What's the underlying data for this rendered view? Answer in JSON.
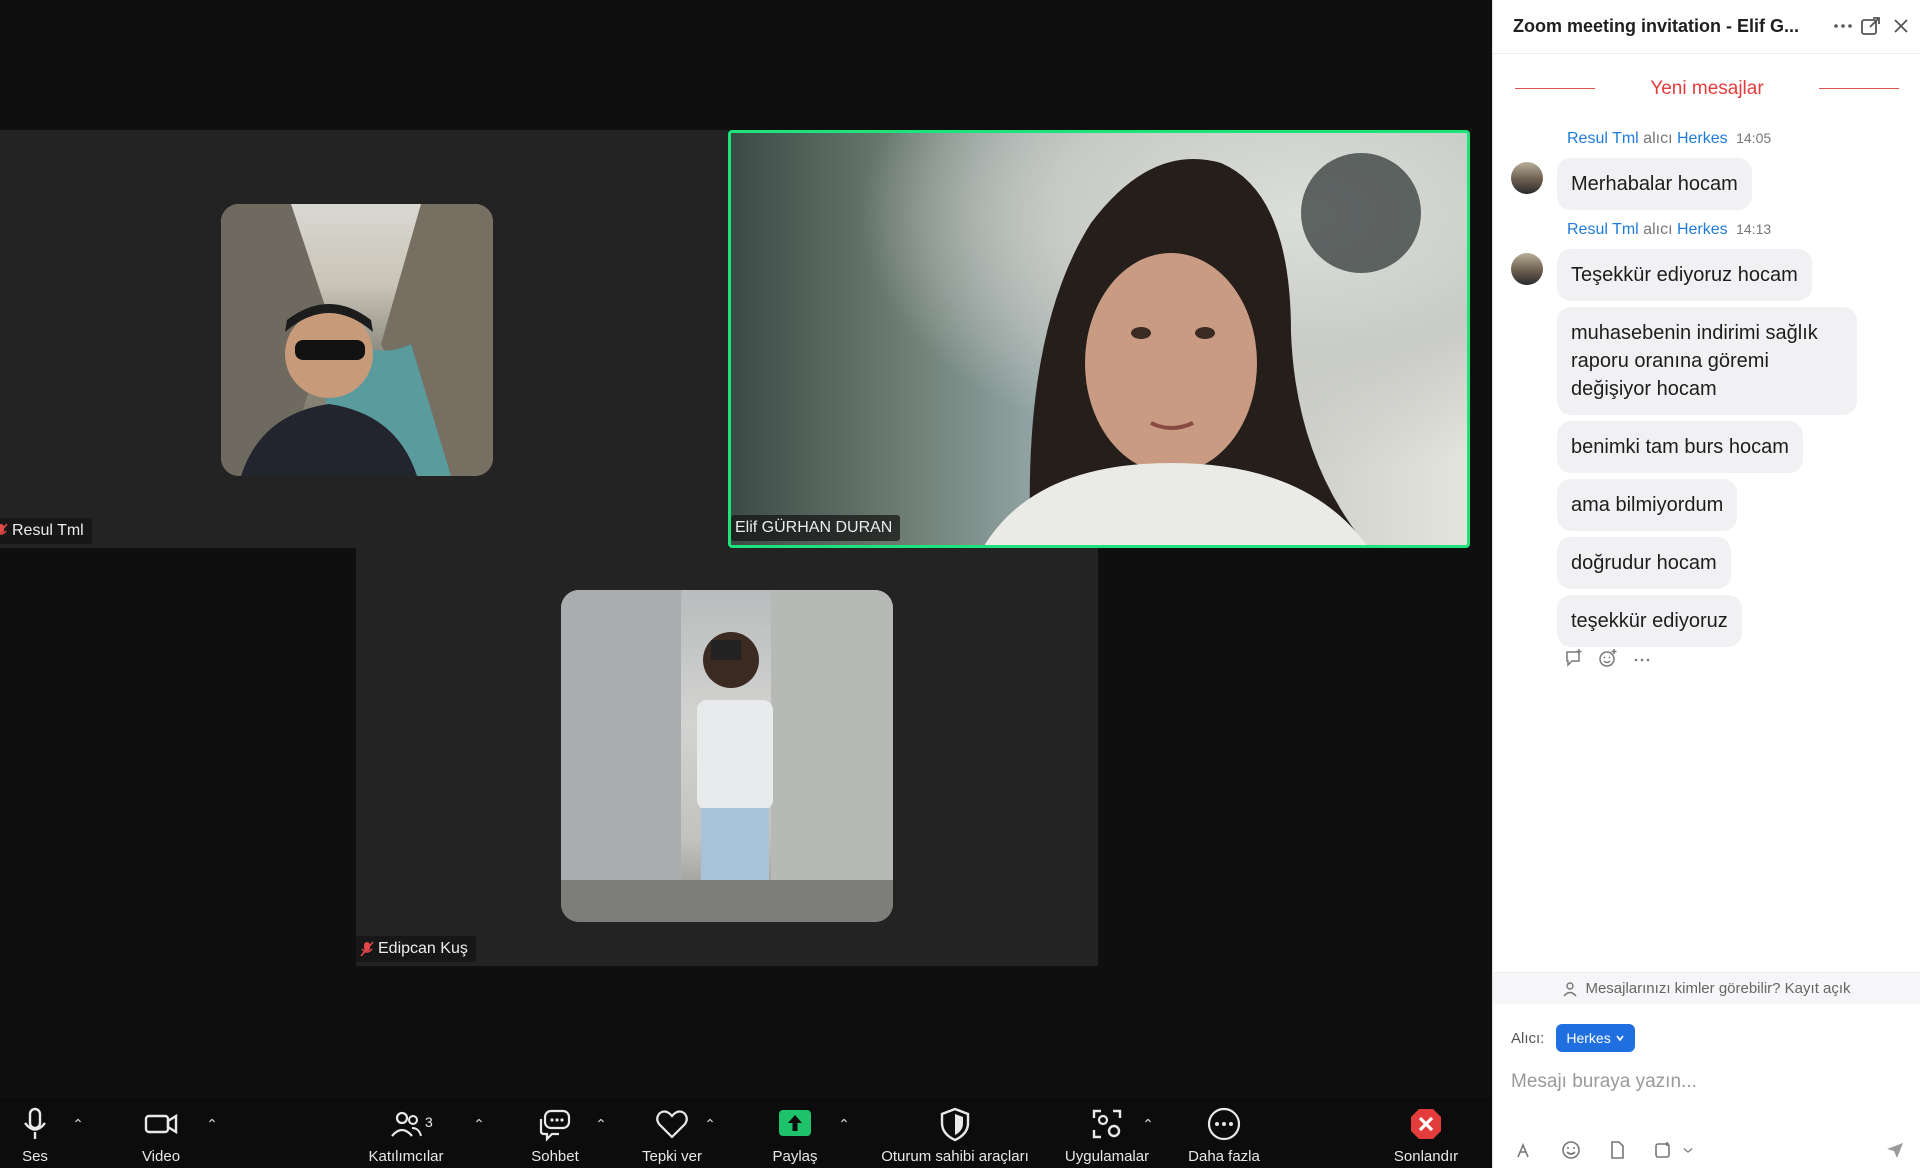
{
  "participants": {
    "resul": {
      "name": "Resul Tml"
    },
    "elif": {
      "name": "Elif GÜRHAN DURAN"
    },
    "edipcan": {
      "name": "Edipcan Kuş"
    }
  },
  "toolbar": {
    "audio": "Ses",
    "video": "Video",
    "participants": "Katılımcılar",
    "participant_count": "3",
    "chat": "Sohbet",
    "react": "Tepki ver",
    "share": "Paylaş",
    "host_tools": "Oturum sahibi araçları",
    "apps": "Uygulamalar",
    "more": "Daha fazla",
    "end": "Sonlandır"
  },
  "chat": {
    "title": "Zoom meeting invitation - Elif G...",
    "new_messages": "Yeni mesajlar",
    "groups": [
      {
        "sender": "Resul Tml",
        "to_word": "alıcı",
        "recipient": "Herkes",
        "time": "14:05",
        "messages": [
          "Merhabalar hocam"
        ]
      },
      {
        "sender": "Resul Tml",
        "to_word": "alıcı",
        "recipient": "Herkes",
        "time": "14:13",
        "messages": [
          "Teşekkür ediyoruz hocam",
          "muhasebenin indirimi sağlık raporu oranına göremi değişiyor hocam",
          "benimki tam burs hocam",
          "ama bilmiyordum",
          "doğrudur hocam",
          "teşekkür ediyoruz"
        ]
      }
    ],
    "privacy_notice": "Mesajlarınızı kimler görebilir? Kayıt açık",
    "to_label": "Alıcı:",
    "to_value": "Herkes",
    "input_placeholder": "Mesajı buraya yazın..."
  },
  "colors": {
    "active_speaker_border": "#1ee37a",
    "share_green": "#1ec26a",
    "end_red": "#e23c3c",
    "link_blue": "#1f7bd8"
  }
}
